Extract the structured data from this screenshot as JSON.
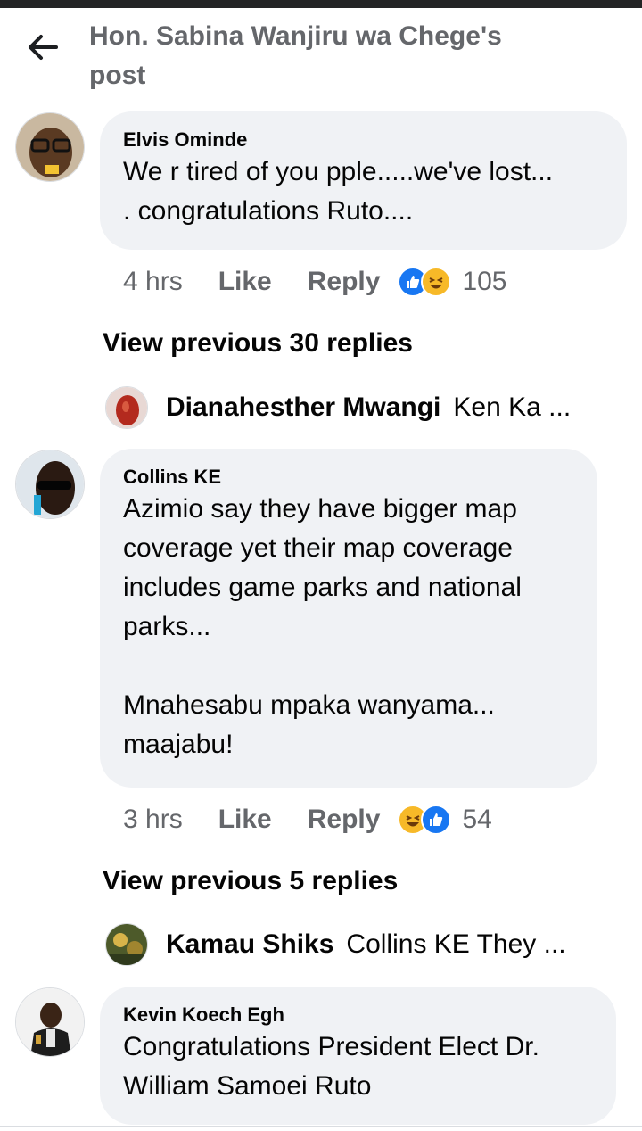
{
  "header": {
    "title": "Hon. Sabina Wanjiru wa Chege's post",
    "back_icon": "arrow-left-icon"
  },
  "colors": {
    "like_blue": "#1877f2",
    "haha_yellow": "#f7b928",
    "bubble_bg": "#f0f2f5",
    "meta_gray": "#65676b"
  },
  "comments": [
    {
      "author": "Elvis Ominde",
      "text": "We r tired of you pple.....we've lost...\n. congratulations Ruto....",
      "time": "4 hrs",
      "like_label": "Like",
      "reply_label": "Reply",
      "reactions": [
        "like-icon",
        "haha-icon"
      ],
      "reaction_count": "105",
      "view_previous": "View previous 30 replies",
      "reply_preview": {
        "name": "Dianahesther Mwangi",
        "text": "Ken Ka ..."
      }
    },
    {
      "author": "Collins KE",
      "text": "Azimio say they have bigger map\ncoverage yet their map coverage\nincludes game parks and national\nparks...\n\nMnahesabu mpaka wanyama...\nmaajabu!",
      "time": "3 hrs",
      "like_label": "Like",
      "reply_label": "Reply",
      "reactions": [
        "haha-icon",
        "like-icon"
      ],
      "reaction_count": "54",
      "view_previous": "View previous 5 replies",
      "reply_preview": {
        "name": "Kamau Shiks",
        "text": "Collins KE They ..."
      }
    },
    {
      "author": "Kevin Koech Egh",
      "text": "Congratulations President Elect Dr.\nWilliam Samoei Ruto"
    }
  ]
}
